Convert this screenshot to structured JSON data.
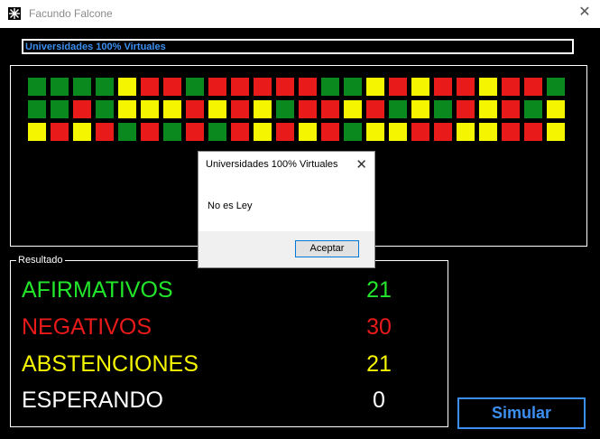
{
  "window": {
    "title": "Facundo Falcone",
    "icon": "snowflake-icon",
    "close": "✕"
  },
  "topic": "Universidades 100% Virtuales",
  "colors": {
    "afirmativo": "#0a8a1e",
    "negativo": "#e81a1a",
    "abstencion": "#f5f500",
    "accent": "#3c8ff0"
  },
  "seats": [
    [
      "G",
      "G",
      "G",
      "G",
      "Y",
      "R",
      "R",
      "G",
      "R",
      "R",
      "R",
      "R",
      "R",
      "G",
      "G",
      "Y",
      "R",
      "Y",
      "R",
      "R",
      "Y",
      "R",
      "R",
      "G"
    ],
    [
      "G",
      "G",
      "R",
      "G",
      "Y",
      "Y",
      "Y",
      "R",
      "Y",
      "R",
      "Y",
      "G",
      "R",
      "R",
      "Y",
      "R",
      "G",
      "Y",
      "G",
      "R",
      "Y",
      "R",
      "G",
      "Y"
    ],
    [
      "Y",
      "R",
      "Y",
      "R",
      "G",
      "R",
      "G",
      "R",
      "G",
      "R",
      "Y",
      "R",
      "Y",
      "R",
      "G",
      "Y",
      "Y",
      "R",
      "R",
      "Y",
      "Y",
      "R",
      "R",
      "Y"
    ]
  ],
  "result": {
    "legend": "Resultado",
    "rows": [
      {
        "label": "AFIRMATIVOS",
        "value": "21"
      },
      {
        "label": "NEGATIVOS",
        "value": "30"
      },
      {
        "label": "ABSTENCIONES",
        "value": "21"
      },
      {
        "label": "ESPERANDO",
        "value": "0"
      }
    ]
  },
  "simular_label": "Simular",
  "dialog": {
    "title": "Universidades 100% Virtuales",
    "message": "No es Ley",
    "ok_label": "Aceptar",
    "close": "✕"
  }
}
